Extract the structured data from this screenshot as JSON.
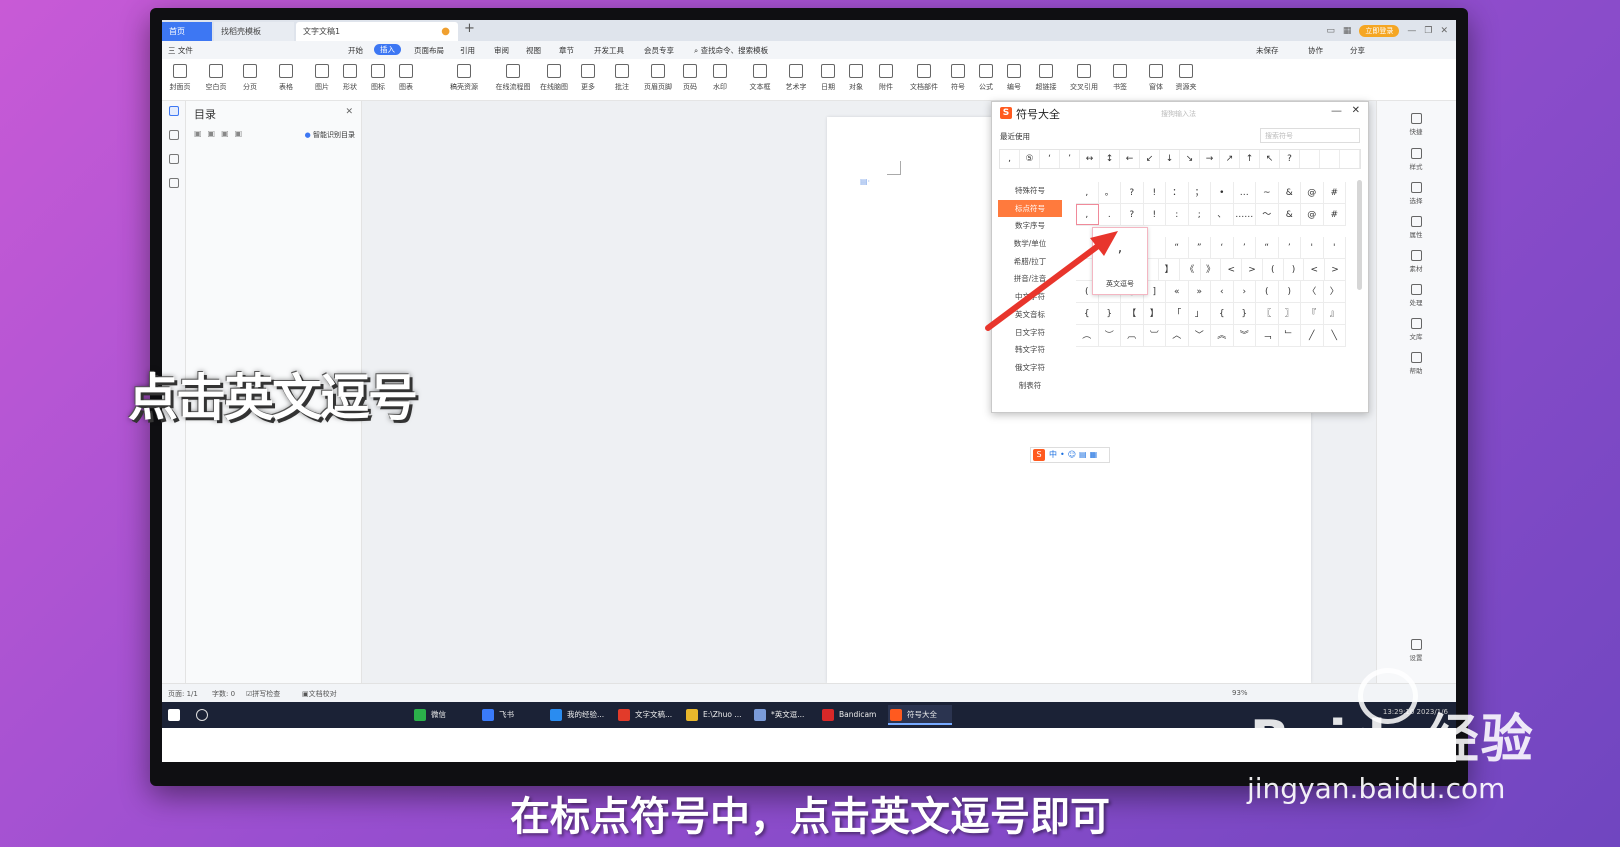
{
  "tabs": {
    "home": "首页",
    "templates": "找稻壳模板",
    "doc": "文字文稿1",
    "new_tab": "+"
  },
  "header_right": {
    "login": "立即登录"
  },
  "menu": {
    "file": "三 文件",
    "items": [
      "开始",
      "插入",
      "页面布局",
      "引用",
      "审阅",
      "视图",
      "章节",
      "开发工具",
      "会员专享"
    ],
    "active": "插入",
    "search": "查找命令、搜索模板",
    "unsaved": "未保存",
    "collab": "协作",
    "share": "分享"
  },
  "ribbon": [
    "封面页",
    "空白页",
    "分页",
    "表格",
    "图片",
    "形状",
    "图标",
    "图表",
    "稿壳资源",
    "在线流程图",
    "在线脑图",
    "更多",
    "批注",
    "页眉页脚",
    "页码",
    "水印",
    "文本框",
    "艺术字",
    "日期",
    "对象",
    "附件",
    "文档部件",
    "符号",
    "公式",
    "编号",
    "超链接",
    "交叉引用",
    "书签",
    "窗体",
    "资源夹"
  ],
  "toc": {
    "title": "目录",
    "smart": "智能识别目录"
  },
  "right_panel": [
    "快捷",
    "样式",
    "选择",
    "属性",
    "素材",
    "处理",
    "文库",
    "帮助",
    "设置"
  ],
  "dialog": {
    "title": "符号大全",
    "subtitle": "搜狗输入法",
    "recent_label": "最近使用",
    "search_placeholder": "搜索符号",
    "recent": [
      ",",
      "⑤",
      "‘",
      "’",
      "↔",
      "↕",
      "←",
      "↙",
      "↓",
      "↘",
      "→",
      "↗",
      "↑",
      "↖",
      "?",
      "",
      "",
      ""
    ],
    "categories": [
      "特殊符号",
      "标点符号",
      "数字序号",
      "数学/单位",
      "希腊/拉丁",
      "拼音/注音",
      "中文字符",
      "英文音标",
      "日文字符",
      "韩文字符",
      "俄文字符",
      "制表符"
    ],
    "active_category": "标点符号",
    "grid": [
      [
        ",",
        "。",
        "?",
        "!",
        "：",
        "；",
        "•",
        "…",
        "~",
        "&",
        "@",
        "#"
      ],
      [
        ",",
        ".",
        "?",
        "!",
        ":",
        ";",
        "、",
        "……",
        "～",
        "&",
        "@",
        "#"
      ],
      [
        "",
        "",
        "",
        "",
        "“",
        "”",
        "‘",
        "’",
        "“",
        "’",
        "'",
        "'"
      ],
      [
        "",
        "",
        "",
        "",
        "】",
        "《",
        "》",
        "<",
        ">",
        "(",
        ")",
        "<",
        ">"
      ],
      [
        "(",
        ")",
        "[",
        "]",
        "«",
        "»",
        "‹",
        "›",
        "(",
        ")",
        "〈",
        "〉"
      ],
      [
        "{",
        "}",
        "【",
        "】",
        "「",
        "」",
        "{",
        "}",
        "〖",
        "〗",
        "『",
        "』"
      ],
      [
        "︵",
        "︶",
        "︹",
        "︺",
        "︿",
        "﹀",
        "︽",
        "︾",
        "﹁",
        "﹂",
        "╱",
        "╲"
      ]
    ],
    "tooltip_char": ",",
    "tooltip_label": "英文逗号"
  },
  "status": {
    "page": "页面: 1/1",
    "words": "字数: 0",
    "spell": "拼写检查",
    "proof": "文档校对",
    "zoom": "93%"
  },
  "taskbar": {
    "apps": [
      {
        "label": "微信",
        "color": "#2bb14a"
      },
      {
        "label": "飞书",
        "color": "#3a7bfa"
      },
      {
        "label": "我的经验...",
        "color": "#2a8cf0"
      },
      {
        "label": "文字文稿...",
        "color": "#e23b2a"
      },
      {
        "label": "E:\\Zhuo ...",
        "color": "#e8b72c"
      },
      {
        "label": "*英文逗...",
        "color": "#7a9bd8"
      },
      {
        "label": "Bandicam",
        "color": "#d92828"
      },
      {
        "label": "符号大全",
        "color": "#ff5a1f"
      }
    ],
    "time": "13:29:10",
    "date": "2023/1/6"
  },
  "overlay": {
    "left_text": "点击英文逗号",
    "caption": "在标点符号中，点击英文逗号即可"
  },
  "watermark": {
    "brand": "Baidu经验",
    "url": "jingyan.baidu.com"
  },
  "colors": {
    "accent": "#3d77f3",
    "sogou": "#ff5a1f",
    "arrow": "#e8352c",
    "category_active": "#ff7a3d"
  }
}
